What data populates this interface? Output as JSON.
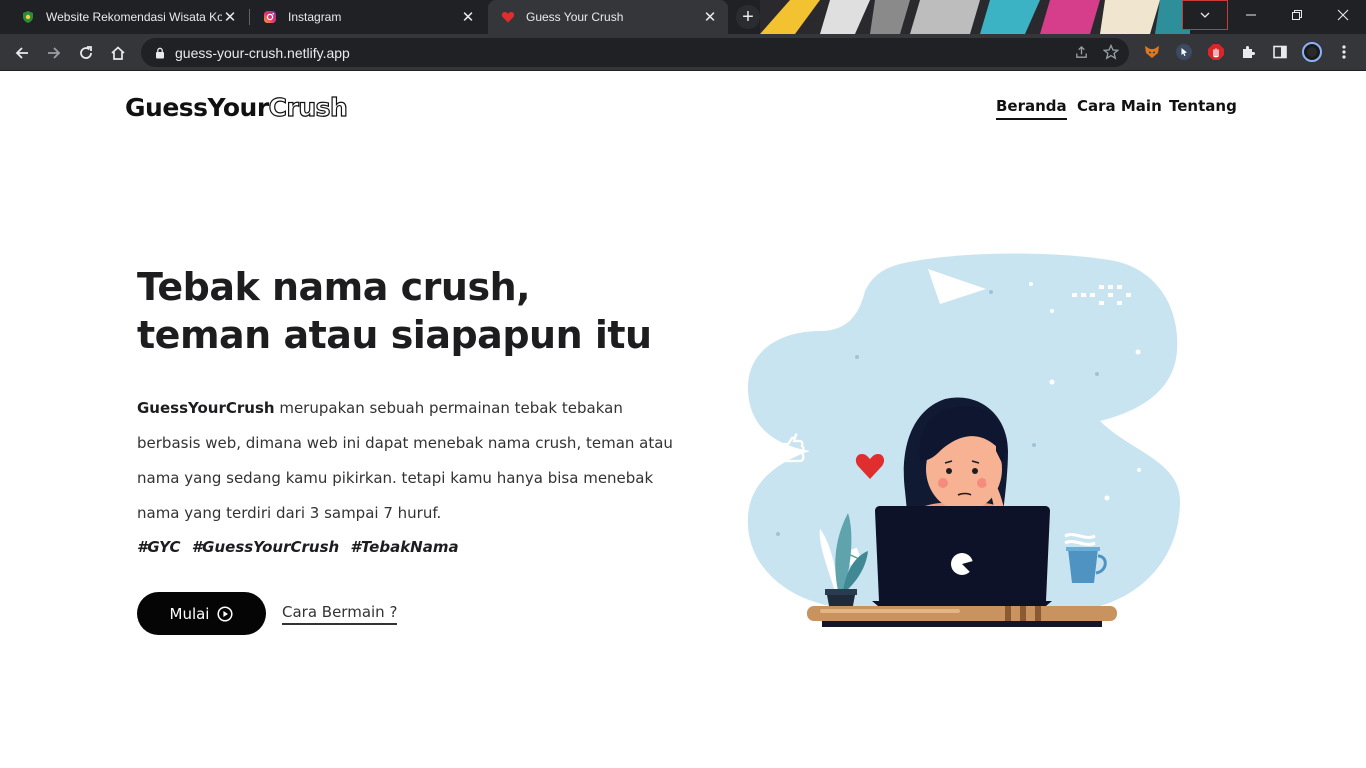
{
  "browser": {
    "tabs": [
      {
        "title": "Website Rekomendasi Wisata Ko",
        "favicon": "shield-green-icon",
        "active": false
      },
      {
        "title": "Instagram",
        "favicon": "instagram-icon",
        "active": false
      },
      {
        "title": "Guess Your Crush",
        "favicon": "heart-icon",
        "active": true
      }
    ],
    "url": "guess-your-crush.netlify.app",
    "colors": {
      "tabstrip": "#202124",
      "toolbar": "#35363a",
      "omnibox": "#202124"
    }
  },
  "site": {
    "logo": {
      "bold": "GuessYour",
      "outline": "Crush"
    },
    "nav": {
      "home": "Beranda",
      "how_to_play": "Cara Main",
      "about": "Tentang"
    },
    "hero": {
      "title_line1": "Tebak nama crush,",
      "title_line2": "teman atau siapapun itu",
      "brand": "GuessYourCrush",
      "description": " merupakan sebuah permainan tebak tebakan berbasis web, dimana web ini dapat menebak nama crush, teman atau nama yang sedang kamu pikirkan. tetapi kamu hanya bisa menebak nama yang terdiri dari 3 sampai 7 huruf.",
      "tags": [
        "#GYC",
        "#GuessYourCrush",
        "#TebakNama"
      ],
      "start_button": "Mulai",
      "howto_link": "Cara Bermain ?"
    },
    "colors": {
      "accent": "#050505",
      "illustration_bg": "#c9e4f1",
      "heart": "#e02d2d"
    }
  }
}
